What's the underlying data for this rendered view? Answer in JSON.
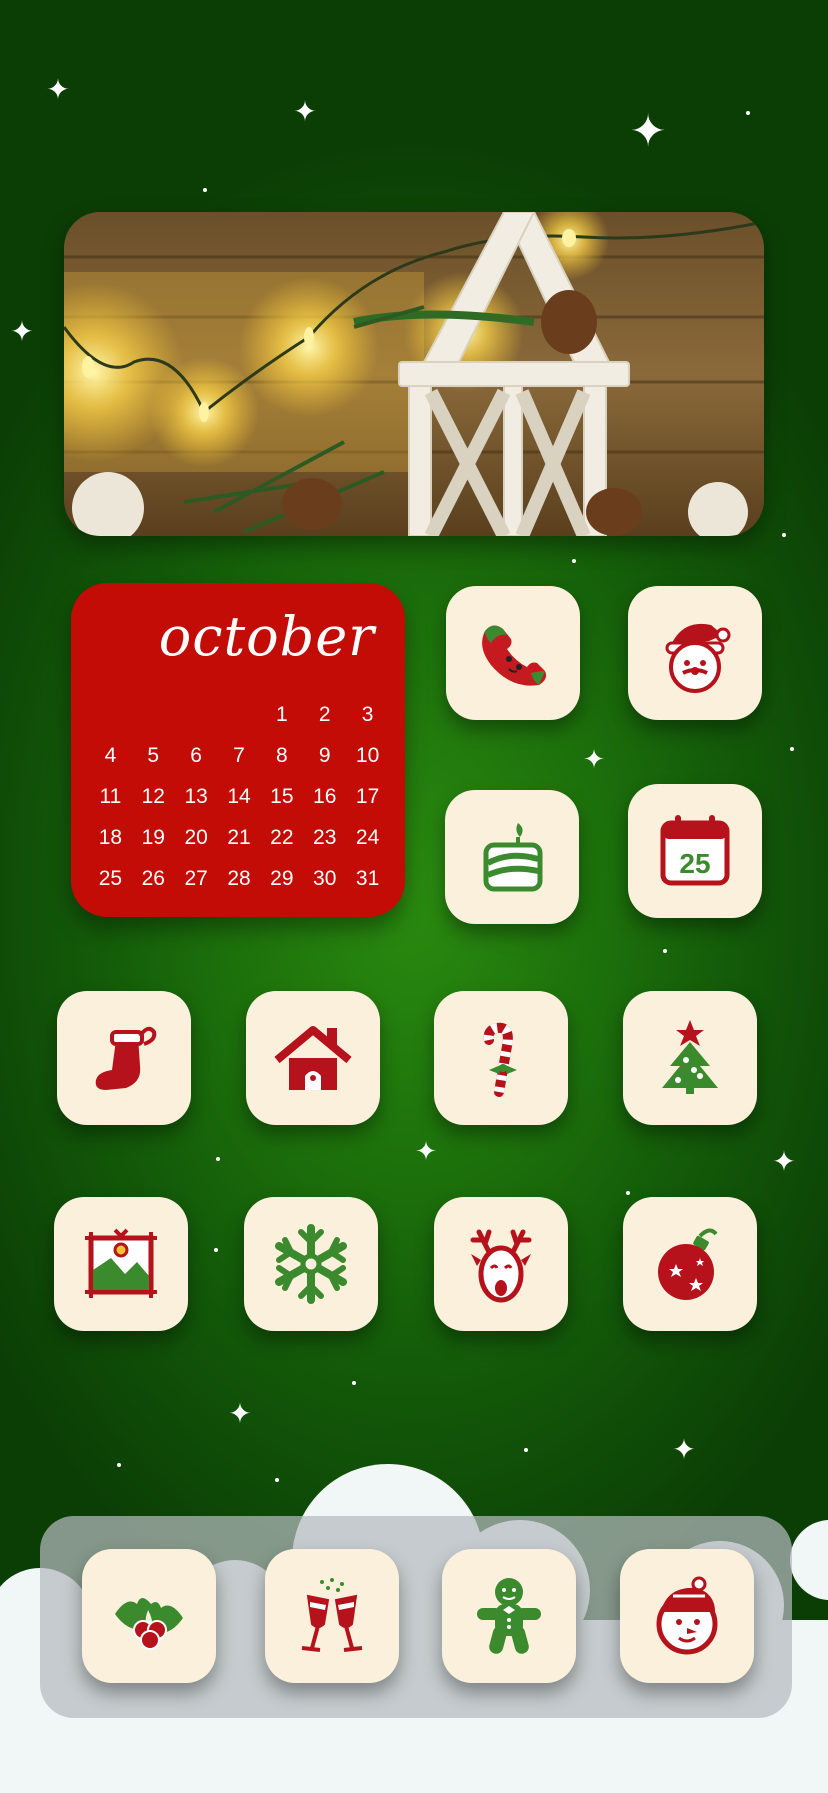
{
  "wallpaper": {
    "colors": {
      "center": "#2a8a10",
      "edge": "#0b3e05",
      "cloud": "#f1f7f7"
    }
  },
  "widgets": {
    "photo": {
      "description_icon": "christmas-lantern-photo"
    },
    "calendar": {
      "month": "october",
      "color": "#c30c05",
      "rows": [
        [
          "",
          "",
          "",
          "",
          "1",
          "2",
          "3"
        ],
        [
          "4",
          "5",
          "6",
          "7",
          "8",
          "9",
          "10"
        ],
        [
          "11",
          "12",
          "13",
          "14",
          "15",
          "16",
          "17"
        ],
        [
          "18",
          "19",
          "20",
          "21",
          "22",
          "23",
          "24"
        ],
        [
          "25",
          "26",
          "27",
          "28",
          "29",
          "30",
          "31"
        ]
      ]
    }
  },
  "apps": {
    "row1": [
      {
        "icon": "phone-icon"
      },
      {
        "icon": "santa-icon"
      }
    ],
    "row2": [
      {
        "icon": "cake-icon"
      },
      {
        "icon": "calendar-25-icon",
        "number": "25"
      }
    ],
    "row3": [
      {
        "icon": "stocking-icon"
      },
      {
        "icon": "house-icon"
      },
      {
        "icon": "candy-cane-icon"
      },
      {
        "icon": "christmas-tree-icon"
      }
    ],
    "row4": [
      {
        "icon": "picture-icon"
      },
      {
        "icon": "snowflake-icon"
      },
      {
        "icon": "reindeer-icon"
      },
      {
        "icon": "ornament-icon"
      }
    ]
  },
  "dock": [
    {
      "icon": "holly-icon"
    },
    {
      "icon": "champagne-icon"
    },
    {
      "icon": "gingerbread-icon"
    },
    {
      "icon": "snowman-icon"
    }
  ],
  "palette": {
    "red": "#b5121b",
    "green": "#3c8a2e",
    "tile": "#faf0dc"
  }
}
